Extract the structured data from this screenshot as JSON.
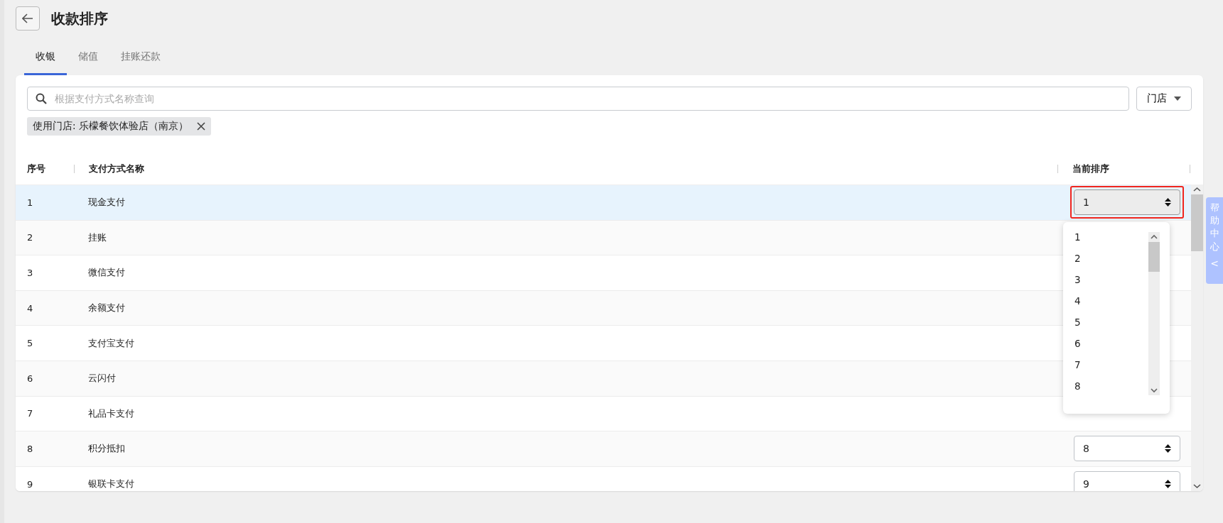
{
  "page": {
    "title": "收款排序"
  },
  "tabs": [
    {
      "label": "收银",
      "selected": true
    },
    {
      "label": "储值",
      "selected": false
    },
    {
      "label": "挂账还款",
      "selected": false
    }
  ],
  "search": {
    "placeholder": "根据支付方式名称查询"
  },
  "store_filter": {
    "label": "门店"
  },
  "filter_chips": [
    {
      "label": "使用门店: 乐檬餐饮体验店（南京）"
    }
  ],
  "table": {
    "columns": [
      "序号",
      "支付方式名称",
      "当前排序"
    ],
    "rows": [
      {
        "index": "1",
        "name": "现金支付",
        "order": "1",
        "selected": true,
        "open": true,
        "annotated": true
      },
      {
        "index": "2",
        "name": "挂账",
        "selected": false
      },
      {
        "index": "3",
        "name": "微信支付",
        "selected": false
      },
      {
        "index": "4",
        "name": "余额支付",
        "selected": false
      },
      {
        "index": "5",
        "name": "支付宝支付",
        "selected": false
      },
      {
        "index": "6",
        "name": "云闪付",
        "selected": false
      },
      {
        "index": "7",
        "name": "礼品卡支付",
        "selected": false
      },
      {
        "index": "8",
        "name": "积分抵扣",
        "order": "8",
        "selected": false
      },
      {
        "index": "9",
        "name": "银联卡支付",
        "order": "9",
        "selected": false
      }
    ]
  },
  "order_dropdown": {
    "options": [
      "1",
      "2",
      "3",
      "4",
      "5",
      "6",
      "7",
      "8"
    ]
  },
  "help_tab": {
    "label": "帮助中心",
    "chevron": "<"
  }
}
